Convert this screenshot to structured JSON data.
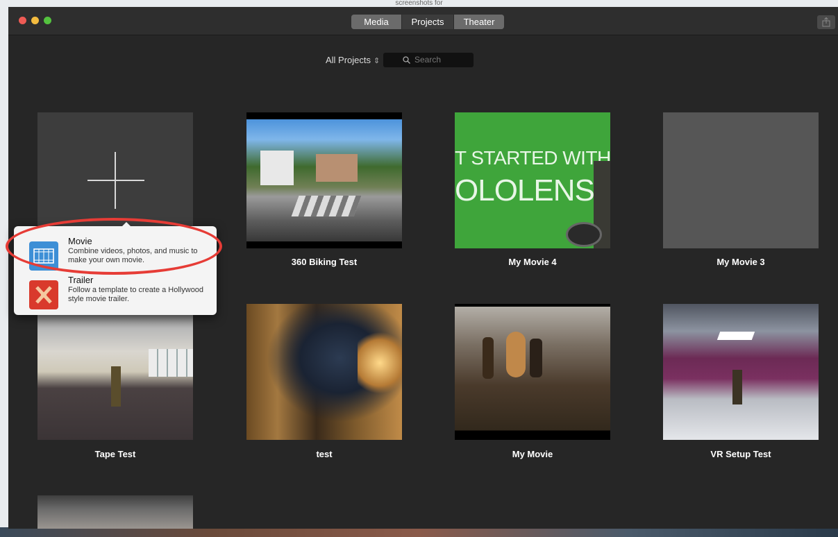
{
  "window": {
    "top_caption": "screenshots for",
    "tabs": [
      {
        "label": "Media"
      },
      {
        "label": "Projects"
      },
      {
        "label": "Theater"
      }
    ]
  },
  "filter": {
    "scope_label": "All Projects",
    "search_placeholder": "Search"
  },
  "projects": [
    {
      "title": "360 Biking Test"
    },
    {
      "title": "My Movie 4",
      "thumb_text_1": "T STARTED WITH",
      "thumb_text_2": "OLOLENS"
    },
    {
      "title": "My Movie 3"
    },
    {
      "title": "Tape Test"
    },
    {
      "title": "test"
    },
    {
      "title": "My Movie"
    },
    {
      "title": "VR Setup Test"
    }
  ],
  "new_project_menu": {
    "items": [
      {
        "title": "Movie",
        "description": "Combine videos, photos, and music to make your own movie."
      },
      {
        "title": "Trailer",
        "description": "Follow a template to create a Hollywood style movie trailer."
      }
    ]
  },
  "colors": {
    "window_bg": "#262626",
    "annotation": "#e63c36",
    "movie_icon": "#3d8fd6",
    "trailer_icon": "#d93a2c"
  }
}
